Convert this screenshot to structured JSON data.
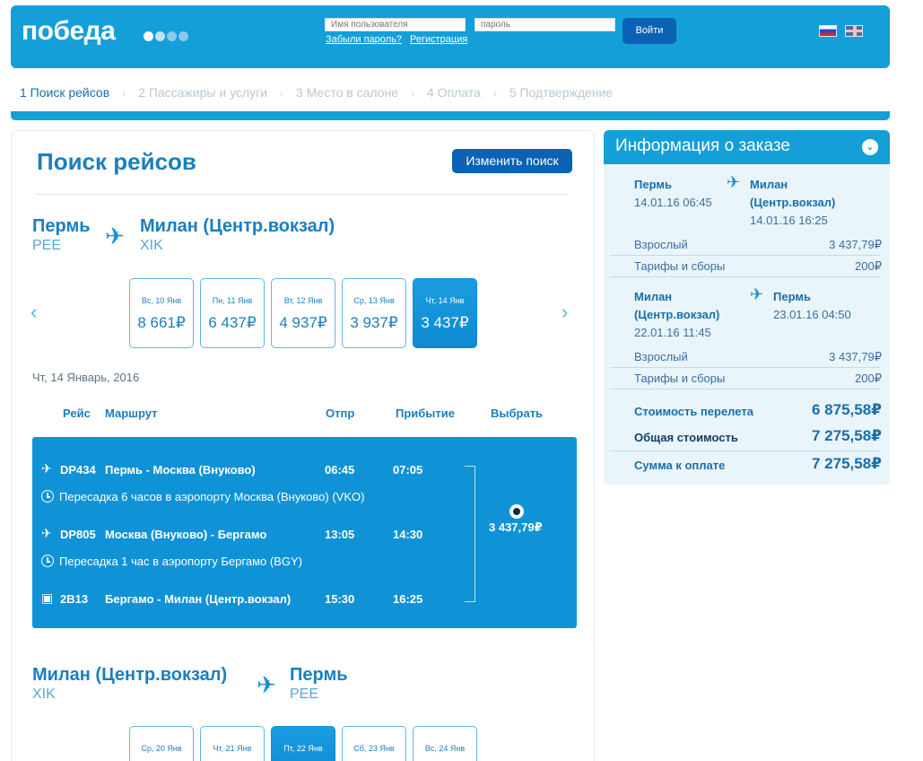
{
  "header": {
    "logo": "победа",
    "username_placeholder": "Имя пользователя",
    "password_placeholder": "пароль",
    "forgot_password": "Забыли пароль?",
    "register": "Регистрация",
    "login_button": "Войти"
  },
  "steps": [
    "1 Поиск рейсов",
    "2 Пассажиры и услуги",
    "3 Место в салоне",
    "4 Оплата",
    "5 Подтверждение"
  ],
  "main": {
    "title": "Поиск рейсов",
    "change_search": "Изменить поиск",
    "outbound": {
      "from_city": "Пермь",
      "from_code": "PEE",
      "to_city": "Милан (Центр.вокзал)",
      "to_code": "XIK",
      "dates": [
        {
          "label": "Вс, 10 Янв",
          "price": "8 661₽"
        },
        {
          "label": "Пн, 11 Янв",
          "price": "6 437₽"
        },
        {
          "label": "Вт, 12 Янв",
          "price": "4 937₽"
        },
        {
          "label": "Ср, 13 Янв",
          "price": "3 937₽"
        },
        {
          "label": "Чт, 14 Янв",
          "price": "3 437₽"
        }
      ],
      "date_heading": "Чт, 14 Январь, 2016"
    },
    "columns": {
      "flight": "Рейс",
      "route": "Маршрут",
      "dep": "Отпр",
      "arr": "Прибытие",
      "select": "Выбрать"
    },
    "flight_option": {
      "segments": [
        {
          "number": "DP434",
          "route": "Пермь - Москва (Внуково)",
          "dep": "06:45",
          "arr": "07:05"
        },
        {
          "number": "DP805",
          "route": "Москва (Внуково) - Бергамо",
          "dep": "13:05",
          "arr": "14:30"
        },
        {
          "number": "2B13",
          "route": "Бергамо - Милан (Центр.вокзал)",
          "dep": "15:30",
          "arr": "16:25"
        }
      ],
      "transfers": [
        "Пересадка 6 часов в аэропорту Москва (Внуково) (VKO)",
        "Пересадка 1 час в аэропорту Бергамо (BGY)"
      ],
      "price": "3 437,79₽"
    },
    "return": {
      "from_city": "Милан (Центр.вокзал)",
      "from_code": "XIK",
      "to_city": "Пермь",
      "to_code": "PEE",
      "dates": [
        {
          "label": "Ср, 20 Янв"
        },
        {
          "label": "Чт, 21 Янв"
        },
        {
          "label": "Пт, 22 Янв"
        },
        {
          "label": "Сб, 23 Янв"
        },
        {
          "label": "Вс, 24 Янв"
        }
      ]
    }
  },
  "order": {
    "title": "Информация о заказе",
    "outbound": {
      "from": "Пермь",
      "from_datetime": "14.01.16 06:45",
      "to_line1": "Милан",
      "to_line2": "(Центр.вокзал)",
      "to_datetime": "14.01.16 16:25",
      "adult_label": "Взрослый",
      "adult_value": "3 437,79₽",
      "fees_label": "Тарифы и сборы",
      "fees_value": "200₽"
    },
    "return": {
      "from_line1": "Милан",
      "from_line2": "(Центр.вокзал)",
      "from_datetime": "22.01.16 11:45",
      "to": "Пермь",
      "to_datetime": "23.01.16 04:50",
      "adult_label": "Взрослый",
      "adult_value": "3 437,79₽",
      "fees_label": "Тарифы и сборы",
      "fees_value": "200₽"
    },
    "flight_cost_label": "Стоимость перелета",
    "flight_cost_value": "6 875,58₽",
    "total_label": "Общая стоимость",
    "total_value": "7 275,58₽",
    "pay_label": "Сумма к оплате",
    "pay_value": "7 275,58₽"
  }
}
